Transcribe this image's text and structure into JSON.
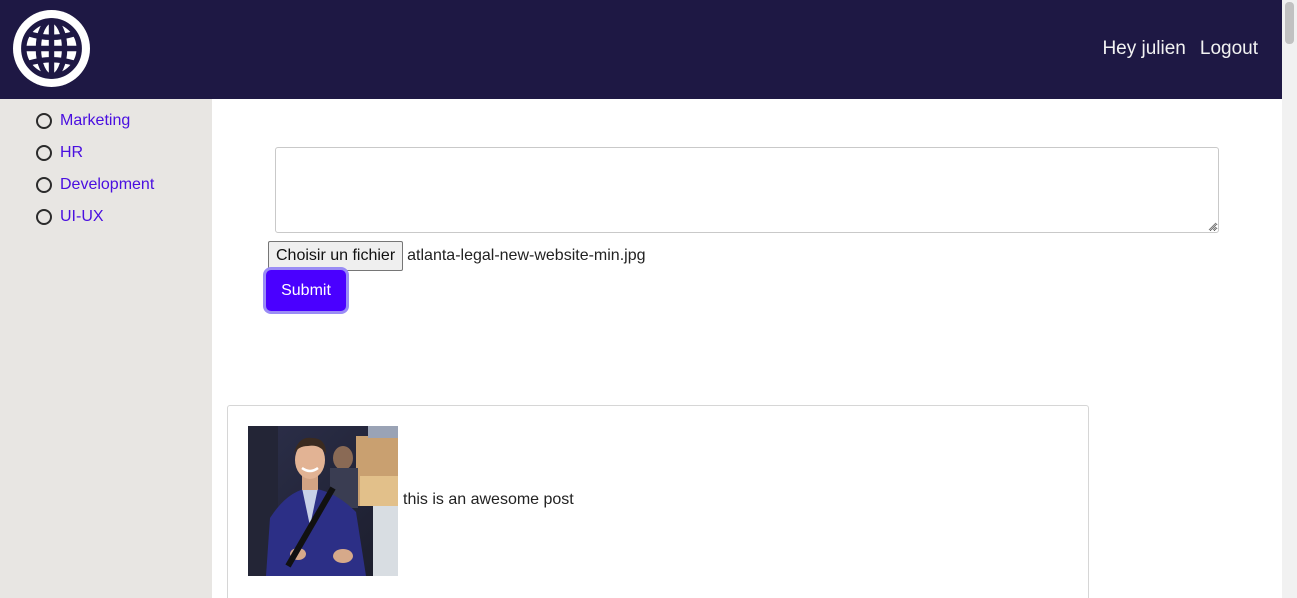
{
  "header": {
    "logo_icon": "globe-icon",
    "greeting": "Hey julien",
    "logout_label": "Logout",
    "background_color": "#1e1844"
  },
  "sidebar": {
    "items": [
      {
        "label": "Marketing"
      },
      {
        "label": "HR"
      },
      {
        "label": "Development"
      },
      {
        "label": "UI-UX"
      }
    ],
    "link_color": "#4a0fe0"
  },
  "post_form": {
    "text_value": "",
    "file_button_label": "Choisir un fichier",
    "file_name": "atlanta-legal-new-website-min.jpg",
    "submit_label": "Submit",
    "accent_color": "#4a00ff"
  },
  "posts": [
    {
      "image_icon": "user-photo",
      "text": "this is an awesome post"
    }
  ]
}
